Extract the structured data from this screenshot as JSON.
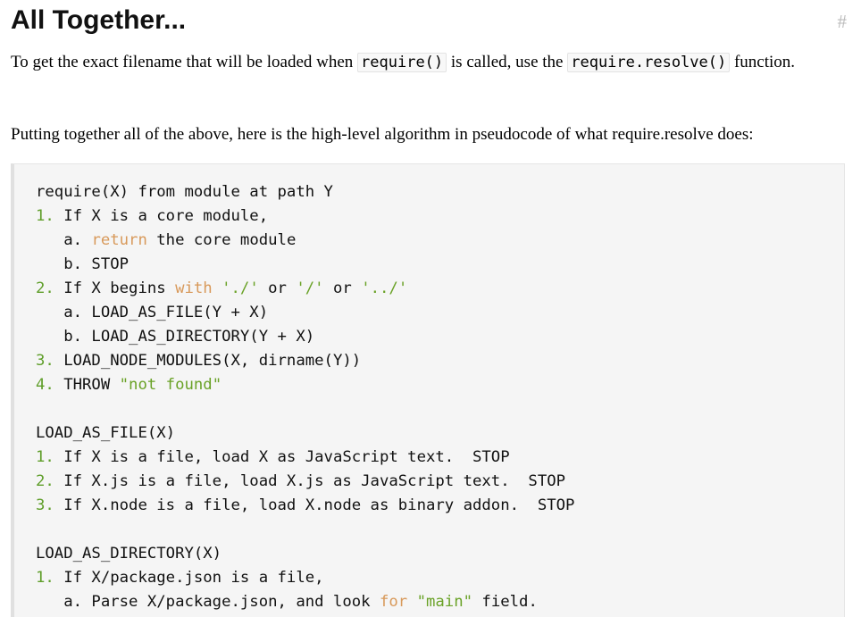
{
  "header": {
    "title": "All Together...",
    "anchor": "#"
  },
  "intro": {
    "before": "To get the exact filename that will be loaded when ",
    "code1": "require()",
    "middle": " is called, use the ",
    "code2": "require.resolve()",
    "after": " function."
  },
  "summary": "Putting together all of the above, here is the high-level algorithm in pseudocode of what require.resolve does:",
  "code": {
    "lines": [
      [
        {
          "t": "require(X) from module at path Y"
        }
      ],
      [
        {
          "t": "1.",
          "c": "num"
        },
        {
          "t": " If X is a core module,"
        }
      ],
      [
        {
          "t": "   a. "
        },
        {
          "t": "return",
          "c": "kw"
        },
        {
          "t": " the core module"
        }
      ],
      [
        {
          "t": "   b. STOP"
        }
      ],
      [
        {
          "t": "2.",
          "c": "num"
        },
        {
          "t": " If X begins "
        },
        {
          "t": "with",
          "c": "kw"
        },
        {
          "t": " "
        },
        {
          "t": "'./'",
          "c": "str"
        },
        {
          "t": " or "
        },
        {
          "t": "'/'",
          "c": "str"
        },
        {
          "t": " or "
        },
        {
          "t": "'../'",
          "c": "str"
        }
      ],
      [
        {
          "t": "   a. LOAD_AS_FILE(Y + X)"
        }
      ],
      [
        {
          "t": "   b. LOAD_AS_DIRECTORY(Y + X)"
        }
      ],
      [
        {
          "t": "3.",
          "c": "num"
        },
        {
          "t": " LOAD_NODE_MODULES(X, dirname(Y))"
        }
      ],
      [
        {
          "t": "4.",
          "c": "num"
        },
        {
          "t": " THROW "
        },
        {
          "t": "\"not found\"",
          "c": "str"
        }
      ],
      [
        {
          "t": ""
        }
      ],
      [
        {
          "t": "LOAD_AS_FILE(X)"
        }
      ],
      [
        {
          "t": "1.",
          "c": "num"
        },
        {
          "t": " If X is a file, load X as JavaScript text.  STOP"
        }
      ],
      [
        {
          "t": "2.",
          "c": "num"
        },
        {
          "t": " If X.js is a file, load X.js as JavaScript text.  STOP"
        }
      ],
      [
        {
          "t": "3.",
          "c": "num"
        },
        {
          "t": " If X.node is a file, load X.node as binary addon.  STOP"
        }
      ],
      [
        {
          "t": ""
        }
      ],
      [
        {
          "t": "LOAD_AS_DIRECTORY(X)"
        }
      ],
      [
        {
          "t": "1.",
          "c": "num"
        },
        {
          "t": " If X/package.json is a file,"
        }
      ],
      [
        {
          "t": "   a. Parse X/package.json, and look "
        },
        {
          "t": "for",
          "c": "kw"
        },
        {
          "t": " "
        },
        {
          "t": "\"main\"",
          "c": "str"
        },
        {
          "t": " field."
        }
      ]
    ]
  }
}
